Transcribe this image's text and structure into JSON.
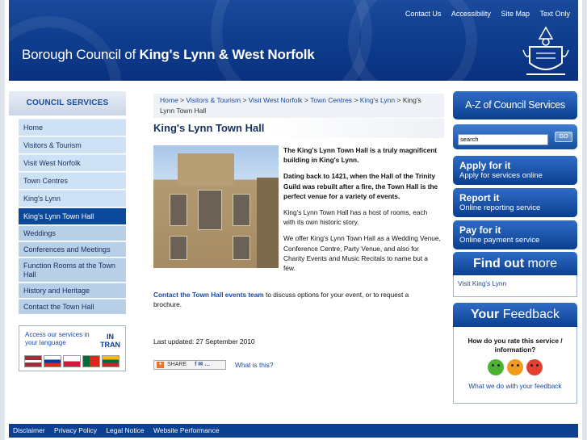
{
  "header": {
    "title_prefix": "Borough Council of ",
    "title_bold": "King's Lynn & West Norfolk",
    "top_links": [
      "Contact Us",
      "Accessibility",
      "Site Map",
      "Text Only"
    ]
  },
  "left_nav": {
    "heading": "COUNCIL SERVICES",
    "items": [
      {
        "label": "Home",
        "state": "normal"
      },
      {
        "label": "Visitors & Tourism",
        "state": "normal"
      },
      {
        "label": "Visit West Norfolk",
        "state": "normal"
      },
      {
        "label": "Town Centres",
        "state": "normal"
      },
      {
        "label": "King's Lynn",
        "state": "normal"
      },
      {
        "label": "King's Lynn Town Hall",
        "state": "active"
      },
      {
        "label": "Weddings",
        "state": "sub"
      },
      {
        "label": "Conferences and Meetings",
        "state": "sub"
      },
      {
        "label": "Function Rooms at the Town Hall",
        "state": "sub"
      },
      {
        "label": "History and Heritage",
        "state": "sub"
      },
      {
        "label": "Contact the Town Hall",
        "state": "sub"
      }
    ],
    "intran": {
      "text": "Access our services in your language",
      "logo_top": "IN",
      "logo_bottom": "TRAN"
    }
  },
  "breadcrumb": {
    "crumbs": [
      "Home",
      "Visitors & Tourism",
      "Visit West Norfolk",
      "Town Centres",
      "King's Lynn"
    ],
    "separator": " > ",
    "current": "King's Lynn Town Hall"
  },
  "main": {
    "title": "King's Lynn Town Hall",
    "intro_bold_1": "The King's Lynn Town Hall is a truly magnificent building in King's Lynn.",
    "intro_bold_2": "Dating back to 1421, when  the Hall of the Trinity Guild was rebuilt after a fire, the Town Hall is the perfect venue for a variety of events.",
    "para_1": "King's Lynn Town Hall has a host of rooms, each with its own historic story.",
    "para_2": "We offer King's Lynn Town Hall as a Wedding Venue, Conference Centre, Party Venue, and also for Charity Events and Music Recitals to name but a few.",
    "contact_link": "Contact the Town Hall events team",
    "contact_rest": " to discuss options for your event, or to request a brochure.",
    "last_updated": "Last updated: 27 September 2010",
    "share_label": "SHARE",
    "what_is_this": "What is this?"
  },
  "right": {
    "az_label": "A-Z of Council Services",
    "search": {
      "value": "search",
      "button": "GO"
    },
    "apply": {
      "title": "Apply for it",
      "sub": "Apply for services online"
    },
    "report": {
      "title": "Report it",
      "sub": "Online reporting service"
    },
    "pay": {
      "title": "Pay for it",
      "sub": "Online payment service"
    },
    "find_out": {
      "prefix": "Find out",
      "suffix": " more",
      "link": "Visit King's Lynn"
    },
    "feedback": {
      "prefix": "Your",
      "suffix": " Feedback",
      "question": "How do you rate this service / information?",
      "link": "What we do with your feedback",
      "faces": [
        "green",
        "amber",
        "red"
      ]
    }
  },
  "footer": {
    "links": [
      "Disclaimer",
      "Privacy Policy",
      "Legal Notice",
      "Website Performance"
    ]
  },
  "colors": {
    "brand_blue": "#0b3f8f",
    "nav_bg": "#cfe2f5",
    "link": "#1a4aa0",
    "face_green": "#4cb332",
    "face_amber": "#f39b1c",
    "face_red": "#e4402f"
  }
}
